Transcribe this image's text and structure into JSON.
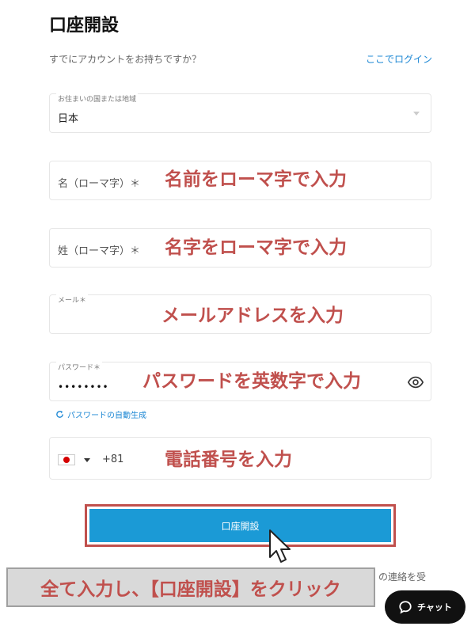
{
  "page": {
    "title": "口座開設",
    "signin_prompt": "すでにアカウントをお持ちですか？",
    "signin_link": "ここでログイン"
  },
  "form": {
    "country": {
      "label": "お住まいの国または地域",
      "value": "日本"
    },
    "first_name": {
      "placeholder": "名（ローマ字）＊"
    },
    "last_name": {
      "placeholder": "姓（ローマ字）＊"
    },
    "email": {
      "label": "メール＊"
    },
    "password": {
      "label": "パスワード＊",
      "value": "••••••••",
      "autogen_label": "パスワードの自動生成"
    },
    "phone": {
      "dial_code": "+81"
    },
    "submit_label": "口座開設"
  },
  "annotations": {
    "first_name": "名前をローマ字で入力",
    "last_name": "名字をローマ字で入力",
    "email": "メールアドレスを入力",
    "password": "パスワードを英数字で入力",
    "phone": "電話番号を入力",
    "callout": "全て入力し、【口座開設】をクリック"
  },
  "footer": {
    "partial_text": "の連絡を受",
    "chat_label": "チャット"
  },
  "icons": {
    "eye": "eye-icon",
    "refresh": "refresh-icon",
    "flag": "japan-flag-icon",
    "cursor": "mouse-pointer-icon",
    "chat": "chat-bubble-icon"
  },
  "colors": {
    "accent": "#1b9ad6",
    "link": "#1e88d4",
    "annotation": "#c0504d"
  }
}
